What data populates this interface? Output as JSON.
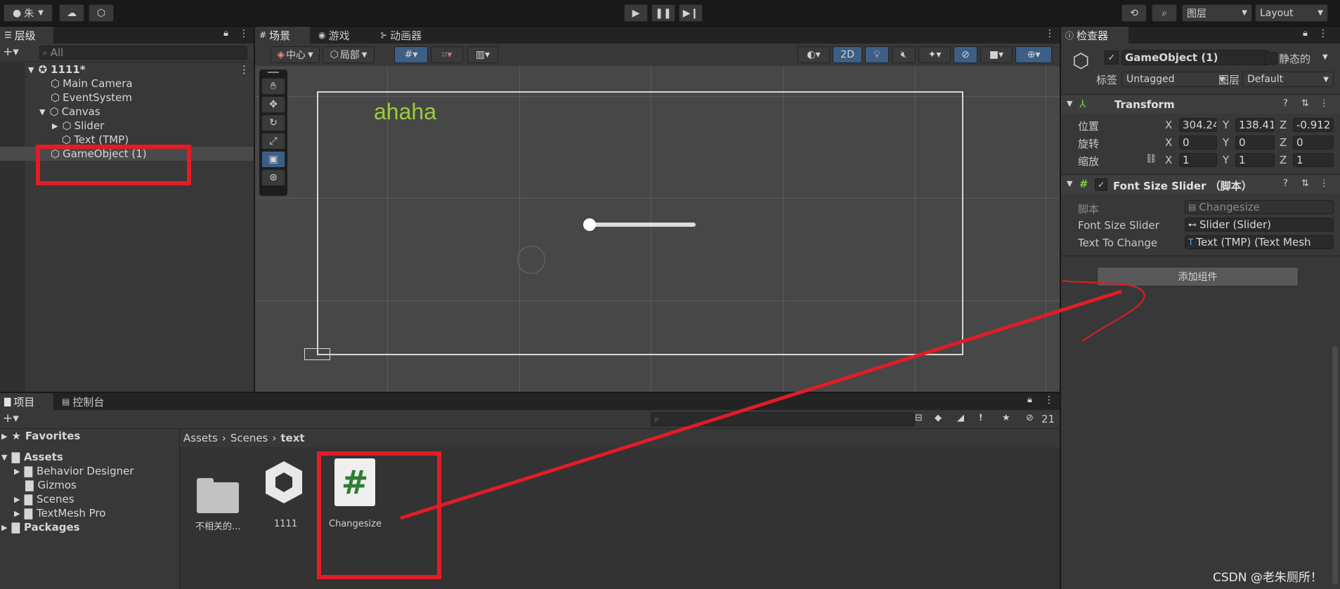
{
  "top_toolbar": {
    "account_label": "朱",
    "layers_label": "图层",
    "layout_label": "Layout"
  },
  "hierarchy": {
    "tab_label": "层级",
    "search_placeholder": "All",
    "scene_name": "1111*",
    "items": [
      "Main Camera",
      "EventSystem",
      "Canvas",
      "Slider",
      "Text (TMP)",
      "GameObject (1)"
    ]
  },
  "scene_view": {
    "tabs": [
      "场景",
      "游戏",
      "动画器"
    ],
    "pivot_label": "中心",
    "space_label": "局部",
    "mode_2d_label": "2D",
    "canvas_text": "ahaha"
  },
  "inspector": {
    "tab_label": "检查器",
    "object_name": "GameObject (1)",
    "static_label": "静态的",
    "tag_label": "标签",
    "tag_value": "Untagged",
    "layer_label": "图层",
    "layer_value": "Default",
    "transform_title": "Transform",
    "position_label": "位置",
    "rotation_label": "旋转",
    "scale_label": "缩放",
    "position": {
      "x": "304.24",
      "y": "138.41",
      "z": "-0.912"
    },
    "rotation": {
      "x": "0",
      "y": "0",
      "z": "0"
    },
    "scale": {
      "x": "1",
      "y": "1",
      "z": "1"
    },
    "script_component_title": "Font Size Slider （脚本）",
    "script_label": "脚本",
    "script_value": "Changesize",
    "font_size_slider_label": "Font Size Slider",
    "font_size_slider_value": "Slider (Slider)",
    "text_to_change_label": "Text To Change",
    "text_to_change_value": "Text (TMP) (Text Mesh",
    "add_component_label": "添加组件"
  },
  "project": {
    "tabs": [
      "项目",
      "控制台"
    ],
    "hidden_count": "21",
    "favorites_label": "Favorites",
    "assets_label": "Assets",
    "asset_folders": [
      "Behavior Designer",
      "Gizmos",
      "Scenes",
      "TextMesh Pro"
    ],
    "packages_label": "Packages",
    "breadcrumb": [
      "Assets",
      "Scenes",
      "text"
    ],
    "files": [
      "不相关的...",
      "1111",
      "Changesize"
    ]
  },
  "watermark": "CSDN @老朱厕所！",
  "colors": {
    "accent_red": "#e21c25",
    "text_green": "#9ccc3c",
    "selected_blue": "#3d5f86"
  }
}
